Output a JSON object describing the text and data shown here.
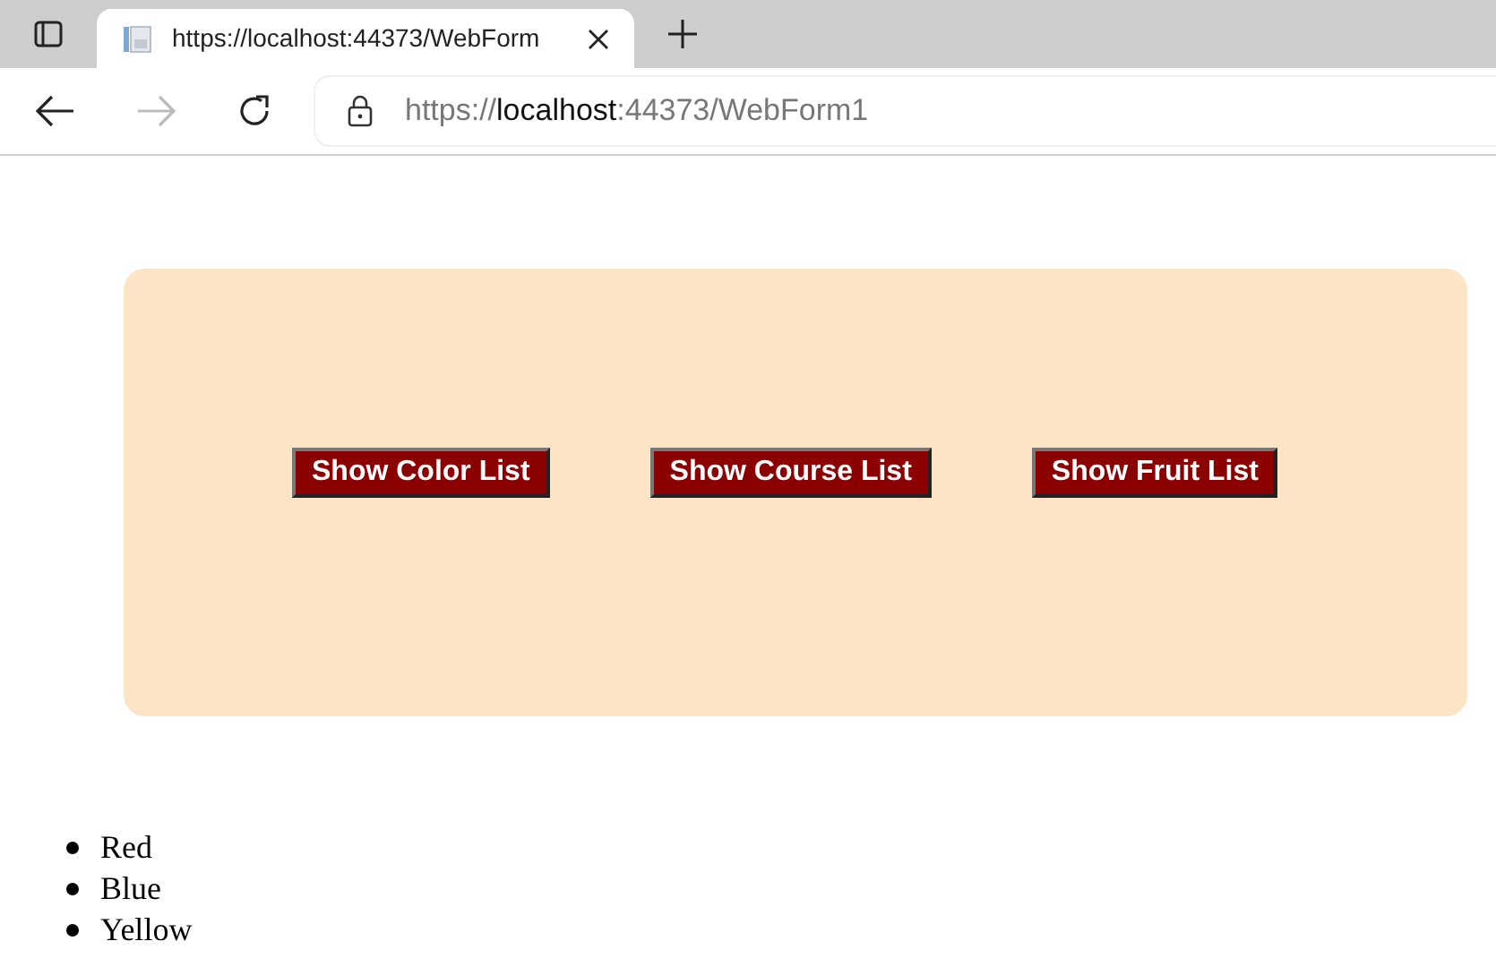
{
  "browser": {
    "tab": {
      "title": "https://localhost:44373/WebForm"
    },
    "address": {
      "scheme": "https://",
      "host": "localhost",
      "rest": ":44373/WebForm1"
    }
  },
  "buttons": [
    "Show Color List",
    "Show Course List",
    "Show Fruit List"
  ],
  "list": [
    "Red",
    "Blue",
    "Yellow"
  ]
}
